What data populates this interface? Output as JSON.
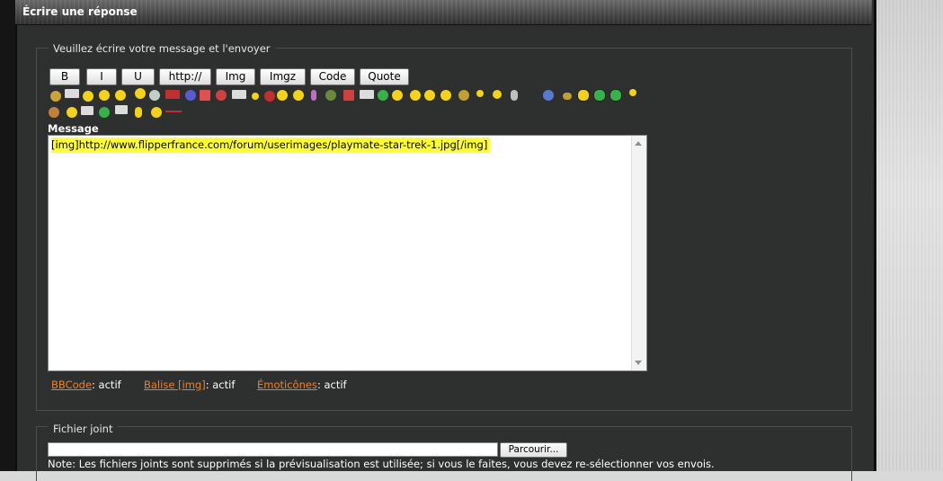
{
  "window": {
    "title": "Écrire une réponse"
  },
  "form": {
    "legend": "Veuillez écrire votre message et l'envoyer",
    "toolbar": {
      "bold": "B",
      "italic": "I",
      "underline": "U",
      "url": "http://",
      "img": "Img",
      "imgz": "Imgz",
      "code": "Code",
      "quote": "Quote"
    },
    "message_label": "Message",
    "message_value": "[img]http://www.flipperfrance.com/forum/userimages/playmate-star-trek-1.jpg[/img]",
    "status": {
      "bbcode_link": "BBCode",
      "bbcode_state": ": actif",
      "img_link": "Balise [img]",
      "img_state": ": actif",
      "emoticons_link": "Émoticônes",
      "emoticons_state": ": actif"
    }
  },
  "attachment": {
    "legend": "Fichier joint",
    "browse_label": "Parcourir...",
    "note": "Note: Les fichiers joints sont supprimés si la prévisualisation est utilisée; si vous le faites, vous devez re-sélectionner vos envois."
  },
  "colors": {
    "panel": "#2e302f",
    "link": "#f0821e",
    "highlight": "#ffff33",
    "smiley_yellow": "#f2d21b",
    "smiley_green": "#37b24a"
  }
}
